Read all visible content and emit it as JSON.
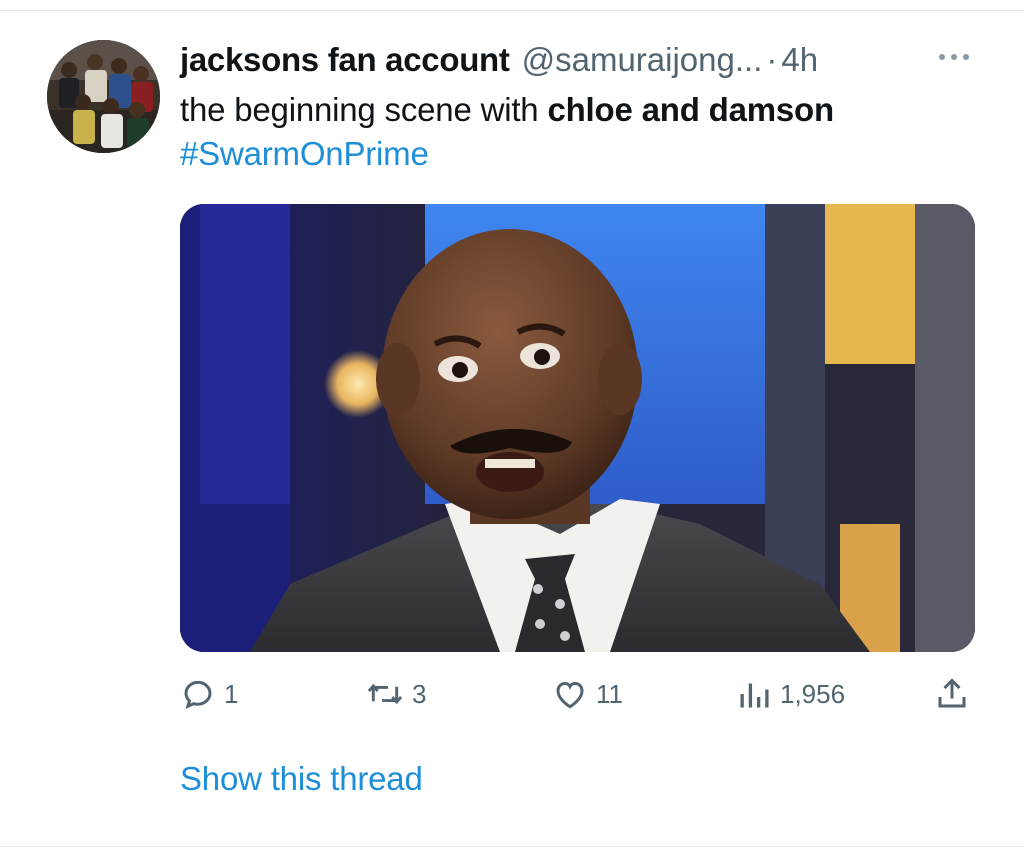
{
  "tweet": {
    "display_name": "jacksons fan account",
    "handle": "@samuraijong...",
    "separator": "·",
    "time": "4h",
    "text_prefix": "the beginning scene with ",
    "text_bold": "chloe and damson",
    "hashtag": "#SwarmOnPrime",
    "media_description_icon": "reaction-photo",
    "actions": {
      "replies": "1",
      "retweets": "3",
      "likes": "11",
      "views": "1,956"
    },
    "show_thread": "Show this thread"
  },
  "icons": {
    "reply": "reply-icon",
    "retweet": "retweet-icon",
    "like": "heart-icon",
    "views": "views-icon",
    "share": "share-icon",
    "more": "more-icon"
  },
  "colors": {
    "link": "#1d8ed8",
    "secondary_text": "#536471",
    "primary_text": "#0f1419"
  }
}
